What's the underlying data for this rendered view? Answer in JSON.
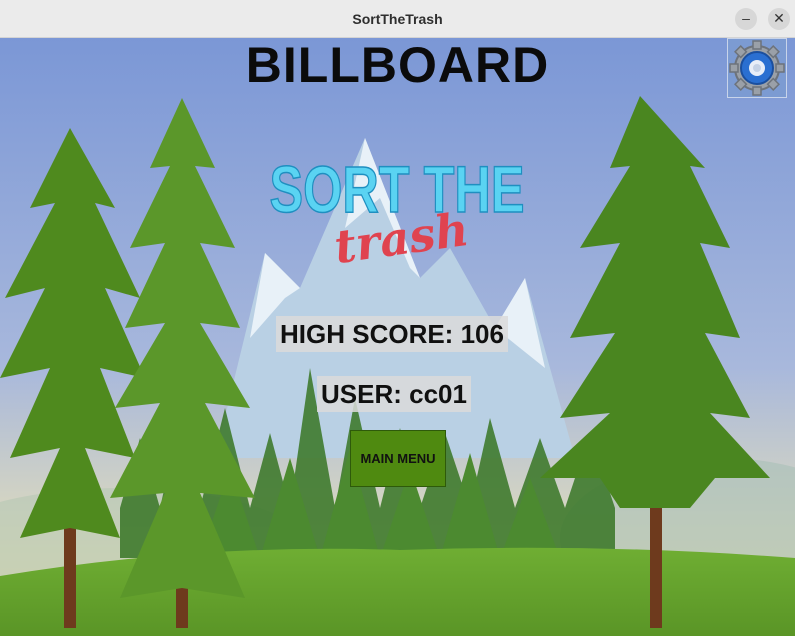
{
  "window": {
    "title": "SortTheTrash",
    "minimize_symbol": "–",
    "close_symbol": "✕"
  },
  "screen": {
    "heading": "BILLBOARD",
    "settings_icon": "gear-icon",
    "logo_text_main": "SORT THE",
    "logo_text_script": "trash",
    "high_score_text": "HIGH SCORE:  106",
    "user_text": "USER:  cc01",
    "main_menu_label": "MAIN MENU"
  },
  "colors": {
    "sky_top": "#7b97d6",
    "sky_bottom": "#efe2a6",
    "grass": "#6aa531",
    "tree_green": "#4f8a1e",
    "button_green": "#4f8a10",
    "logo_cyan": "#5ad3f2",
    "logo_red": "#e0434f"
  }
}
